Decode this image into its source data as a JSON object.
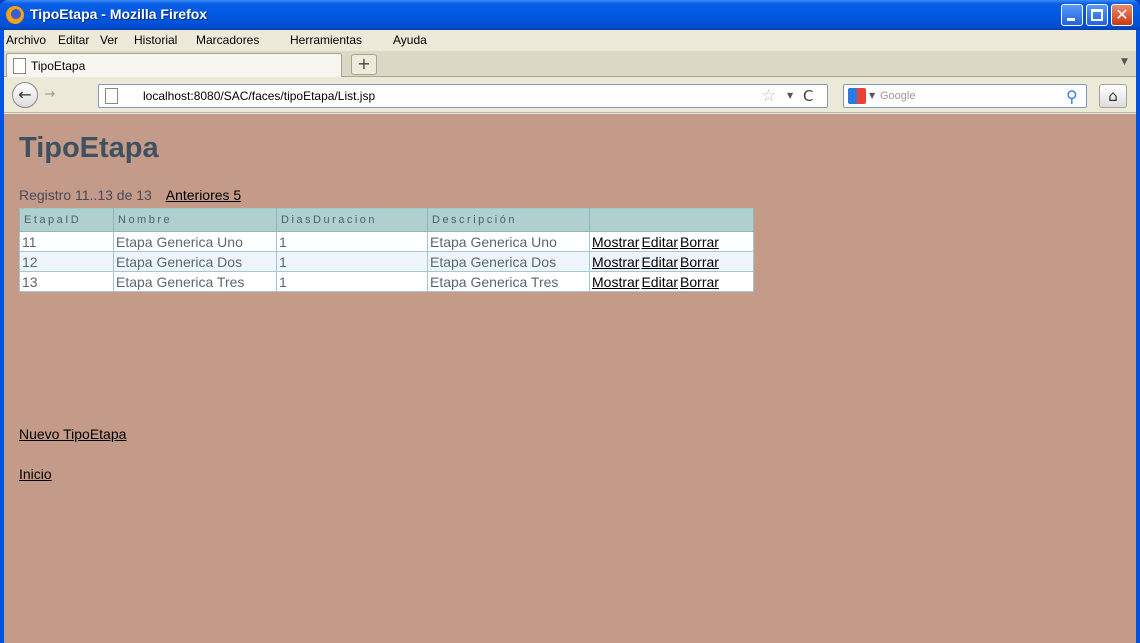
{
  "window": {
    "title": "TipoEtapa - Mozilla Firefox",
    "close_glyph": "✕"
  },
  "menu": [
    "Archivo",
    "Editar",
    "Ver",
    "Historial",
    "Marcadores",
    "Herramientas",
    "Ayuda"
  ],
  "tab": {
    "label": "TipoEtapa",
    "new_tab_glyph": "+"
  },
  "nav": {
    "url": "localhost:8080/SAC/faces/tipoEtapa/List.jsp",
    "search_placeholder": "Google",
    "back_glyph": "←",
    "forward_glyph": "→",
    "reload_glyph": "C",
    "star_glyph": "☆",
    "home_glyph": "⌂",
    "search_glyph": "⚲"
  },
  "page": {
    "title": "TipoEtapa",
    "registro": "Registro 11..13 de 13",
    "anteriores": "Anteriores 5",
    "columns": [
      "EtapaID",
      "Nombre",
      "DiasDuracion",
      "Descripción",
      ""
    ],
    "rows": [
      {
        "id": "11",
        "nombre": "Etapa Generica Uno",
        "dias": "1",
        "descripcion": "Etapa Generica Uno"
      },
      {
        "id": "12",
        "nombre": "Etapa Generica Dos",
        "dias": "1",
        "descripcion": "Etapa Generica Dos"
      },
      {
        "id": "13",
        "nombre": "Etapa Generica Tres",
        "dias": "1",
        "descripcion": "Etapa Generica Tres"
      }
    ],
    "actions": {
      "mostrar": "Mostrar",
      "editar": "Editar",
      "borrar": "Borrar"
    },
    "nuevo_link": "Nuevo TipoEtapa",
    "inicio_link": "Inicio"
  },
  "colors": {
    "content_bg": "#c49a88",
    "title_color": "#3f5161",
    "header_bg": "#b0d0d0",
    "titlebar_blue": "#0058e0"
  }
}
